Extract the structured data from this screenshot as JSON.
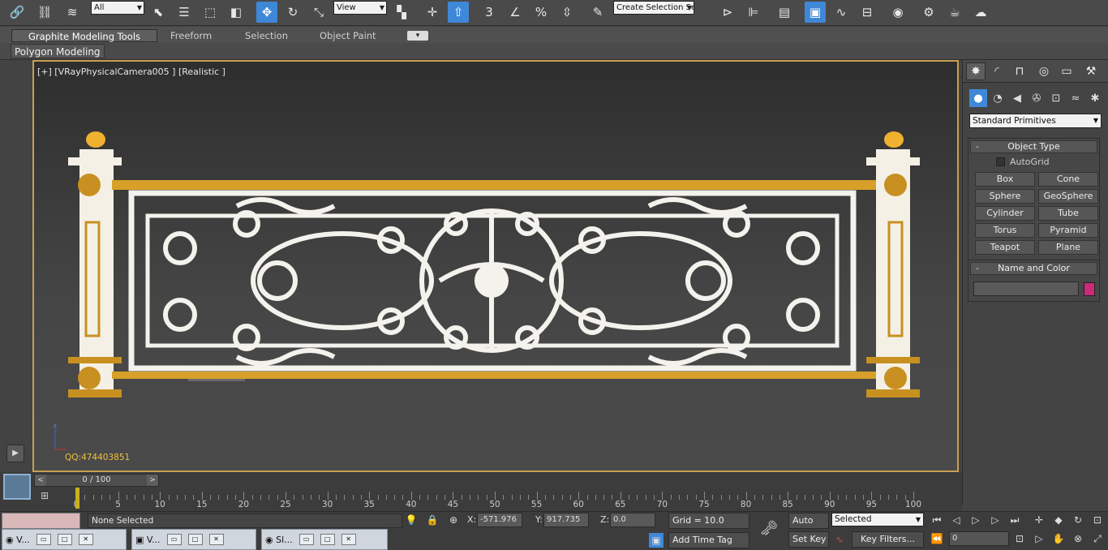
{
  "toolbar": {
    "selection_filter": "All",
    "reference_coord": "View",
    "named_selection": "Create Selection Se",
    "icons": [
      "link-icon",
      "unlink-icon",
      "bind-spacewarp-icon",
      "select-object-icon",
      "select-by-name-icon",
      "rect-region-icon",
      "window-crossing-icon",
      "move-icon",
      "rotate-icon",
      "scale-icon",
      "use-pivot-icon",
      "manipulate-icon",
      "keyboard-shortcut-icon",
      "snap-3-icon",
      "angle-snap-icon",
      "percent-snap-icon",
      "spinner-snap-icon",
      "edit-named-sel-icon",
      "mirror-icon",
      "align-icon",
      "layer-icon",
      "scene-explorer-icon",
      "curve-editor-icon",
      "schematic-icon",
      "material-editor-icon",
      "render-setup-icon",
      "rendered-frame-icon",
      "render-icon"
    ]
  },
  "ribbon": {
    "tabs": [
      "Graphite Modeling Tools",
      "Freeform",
      "Selection",
      "Object Paint"
    ],
    "active_tab": "Graphite Modeling Tools",
    "sub_tab": "Polygon Modeling"
  },
  "viewport": {
    "label": "[+] [VRayPhysicalCamera005 ] [Realistic ]",
    "watermark": "QQ:474403851",
    "axis_z": "z"
  },
  "command_panel": {
    "category": "Standard Primitives",
    "object_type_title": "Object Type",
    "autogrid_label": "AutoGrid",
    "primitives": [
      "Box",
      "Cone",
      "Sphere",
      "GeoSphere",
      "Cylinder",
      "Tube",
      "Torus",
      "Pyramid",
      "Teapot",
      "Plane"
    ],
    "name_color_title": "Name and Color",
    "object_color": "#cc2a7a"
  },
  "timeline": {
    "frame_display": "0 / 100",
    "ticks": [
      0,
      5,
      10,
      15,
      20,
      25,
      30,
      35,
      40,
      45,
      50,
      55,
      60,
      65,
      70,
      75,
      80,
      85,
      90,
      95,
      100
    ]
  },
  "status": {
    "selection_text": "None Selected",
    "x_label": "X:",
    "x_value": "-571.976",
    "y_label": "Y:",
    "y_value": "917.735",
    "z_label": "Z:",
    "z_value": "0.0",
    "grid": "Grid = 10.0",
    "add_time_tag": "Add Time Tag",
    "auto_key": "Auto Key",
    "set_key": "Set Key",
    "key_mode": "Selected",
    "key_filters": "Key Filters...",
    "frame_value": "0"
  },
  "taskbar": [
    {
      "label": "V..."
    },
    {
      "label": "V..."
    },
    {
      "label": "Sl..."
    }
  ],
  "colors": {
    "accent": "#3f88d8",
    "viewport_border": "#c8a050",
    "gold": "#d8a028"
  }
}
